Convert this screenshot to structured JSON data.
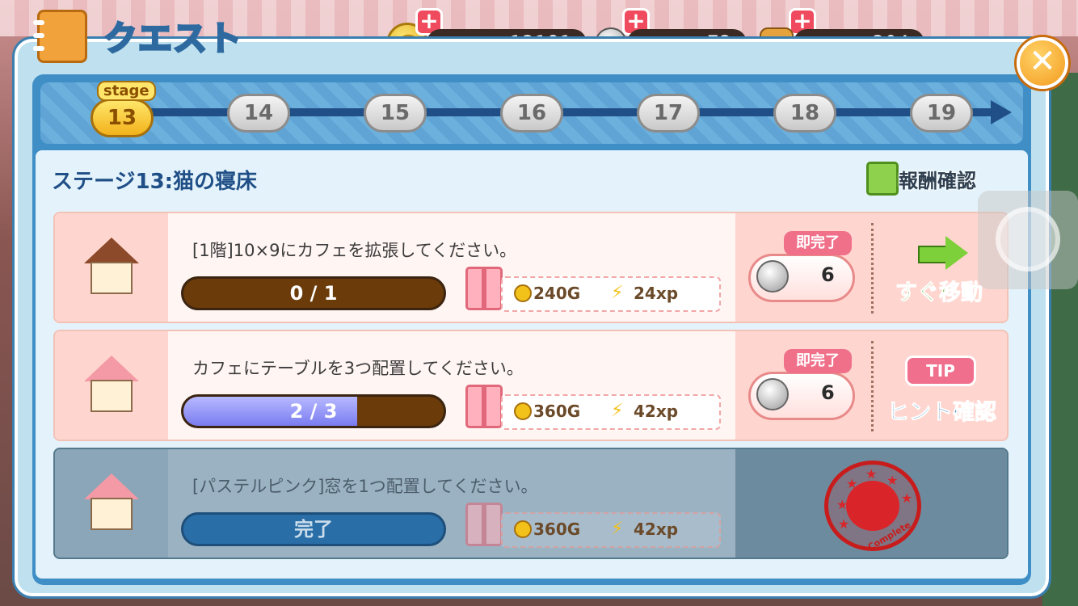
{
  "header": {
    "title": "クエスト",
    "close_icon": "close-icon",
    "quest_book_icon": "notebook-icon"
  },
  "resources": {
    "gold": "13181",
    "bells": "72",
    "food": "304",
    "gold_coin_letter": "G"
  },
  "stages": {
    "label": "stage",
    "current": "13",
    "upcoming": [
      "14",
      "15",
      "16",
      "17",
      "18",
      "19"
    ]
  },
  "stage_detail": {
    "title": "ステージ13:猫の寝床",
    "reward_check_label": "報酬確認"
  },
  "quests": [
    {
      "title": "[1階]10×9にカフェを拡張してください。",
      "progress_text": "0 / 1",
      "progress_fraction": 0,
      "reward_gold": "240G",
      "reward_xp": "24xp",
      "instant_tag": "即完了",
      "instant_cost": "6",
      "action_label": "すぐ移動",
      "status": "in-progress"
    },
    {
      "title": "カフェにテーブルを3つ配置してください。",
      "progress_text": "2 / 3",
      "progress_fraction": 0.667,
      "reward_gold": "360G",
      "reward_xp": "42xp",
      "instant_tag": "即完了",
      "instant_cost": "6",
      "action_badge": "TIP",
      "action_label": "ヒント確認",
      "status": "in-progress"
    },
    {
      "title": "[パステルピンク]窓を1つ配置してください。",
      "progress_text": "完了",
      "progress_fraction": 1,
      "reward_gold": "360G",
      "reward_xp": "42xp",
      "stamp_text": "Complete",
      "status": "complete"
    }
  ],
  "colors": {
    "panel_border": "#3a7fb0",
    "title_text": "#1f4f86",
    "progress_fill": "#7a7cf0",
    "complete_stamp": "#c81c1c"
  }
}
